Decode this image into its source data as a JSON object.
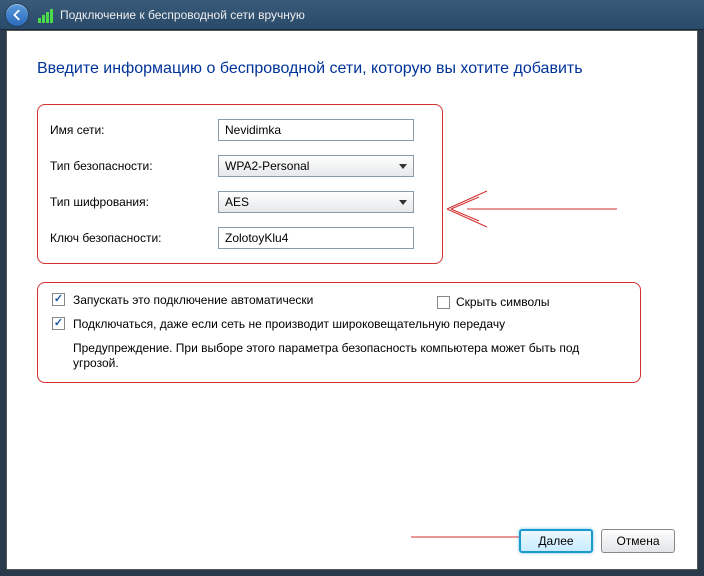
{
  "titlebar": {
    "title": "Подключение к беспроводной сети вручную"
  },
  "heading": "Введите информацию о беспроводной сети, которую вы хотите добавить",
  "form": {
    "ssid_label": "Имя сети:",
    "ssid_value": "Nevidimka",
    "security_label": "Тип безопасности:",
    "security_value": "WPA2-Personal",
    "encryption_label": "Тип шифрования:",
    "encryption_value": "AES",
    "key_label": "Ключ безопасности:",
    "key_value": "ZolotoyKlu4",
    "hide_label": "Скрыть символы"
  },
  "options": {
    "auto_label": "Запускать это подключение автоматически",
    "hidden_label": "Подключаться, даже если сеть не производит широковещательную передачу",
    "warning": "Предупреждение. При выборе этого параметра безопасность компьютера может быть под угрозой."
  },
  "buttons": {
    "next": "Далее",
    "cancel": "Отмена"
  }
}
